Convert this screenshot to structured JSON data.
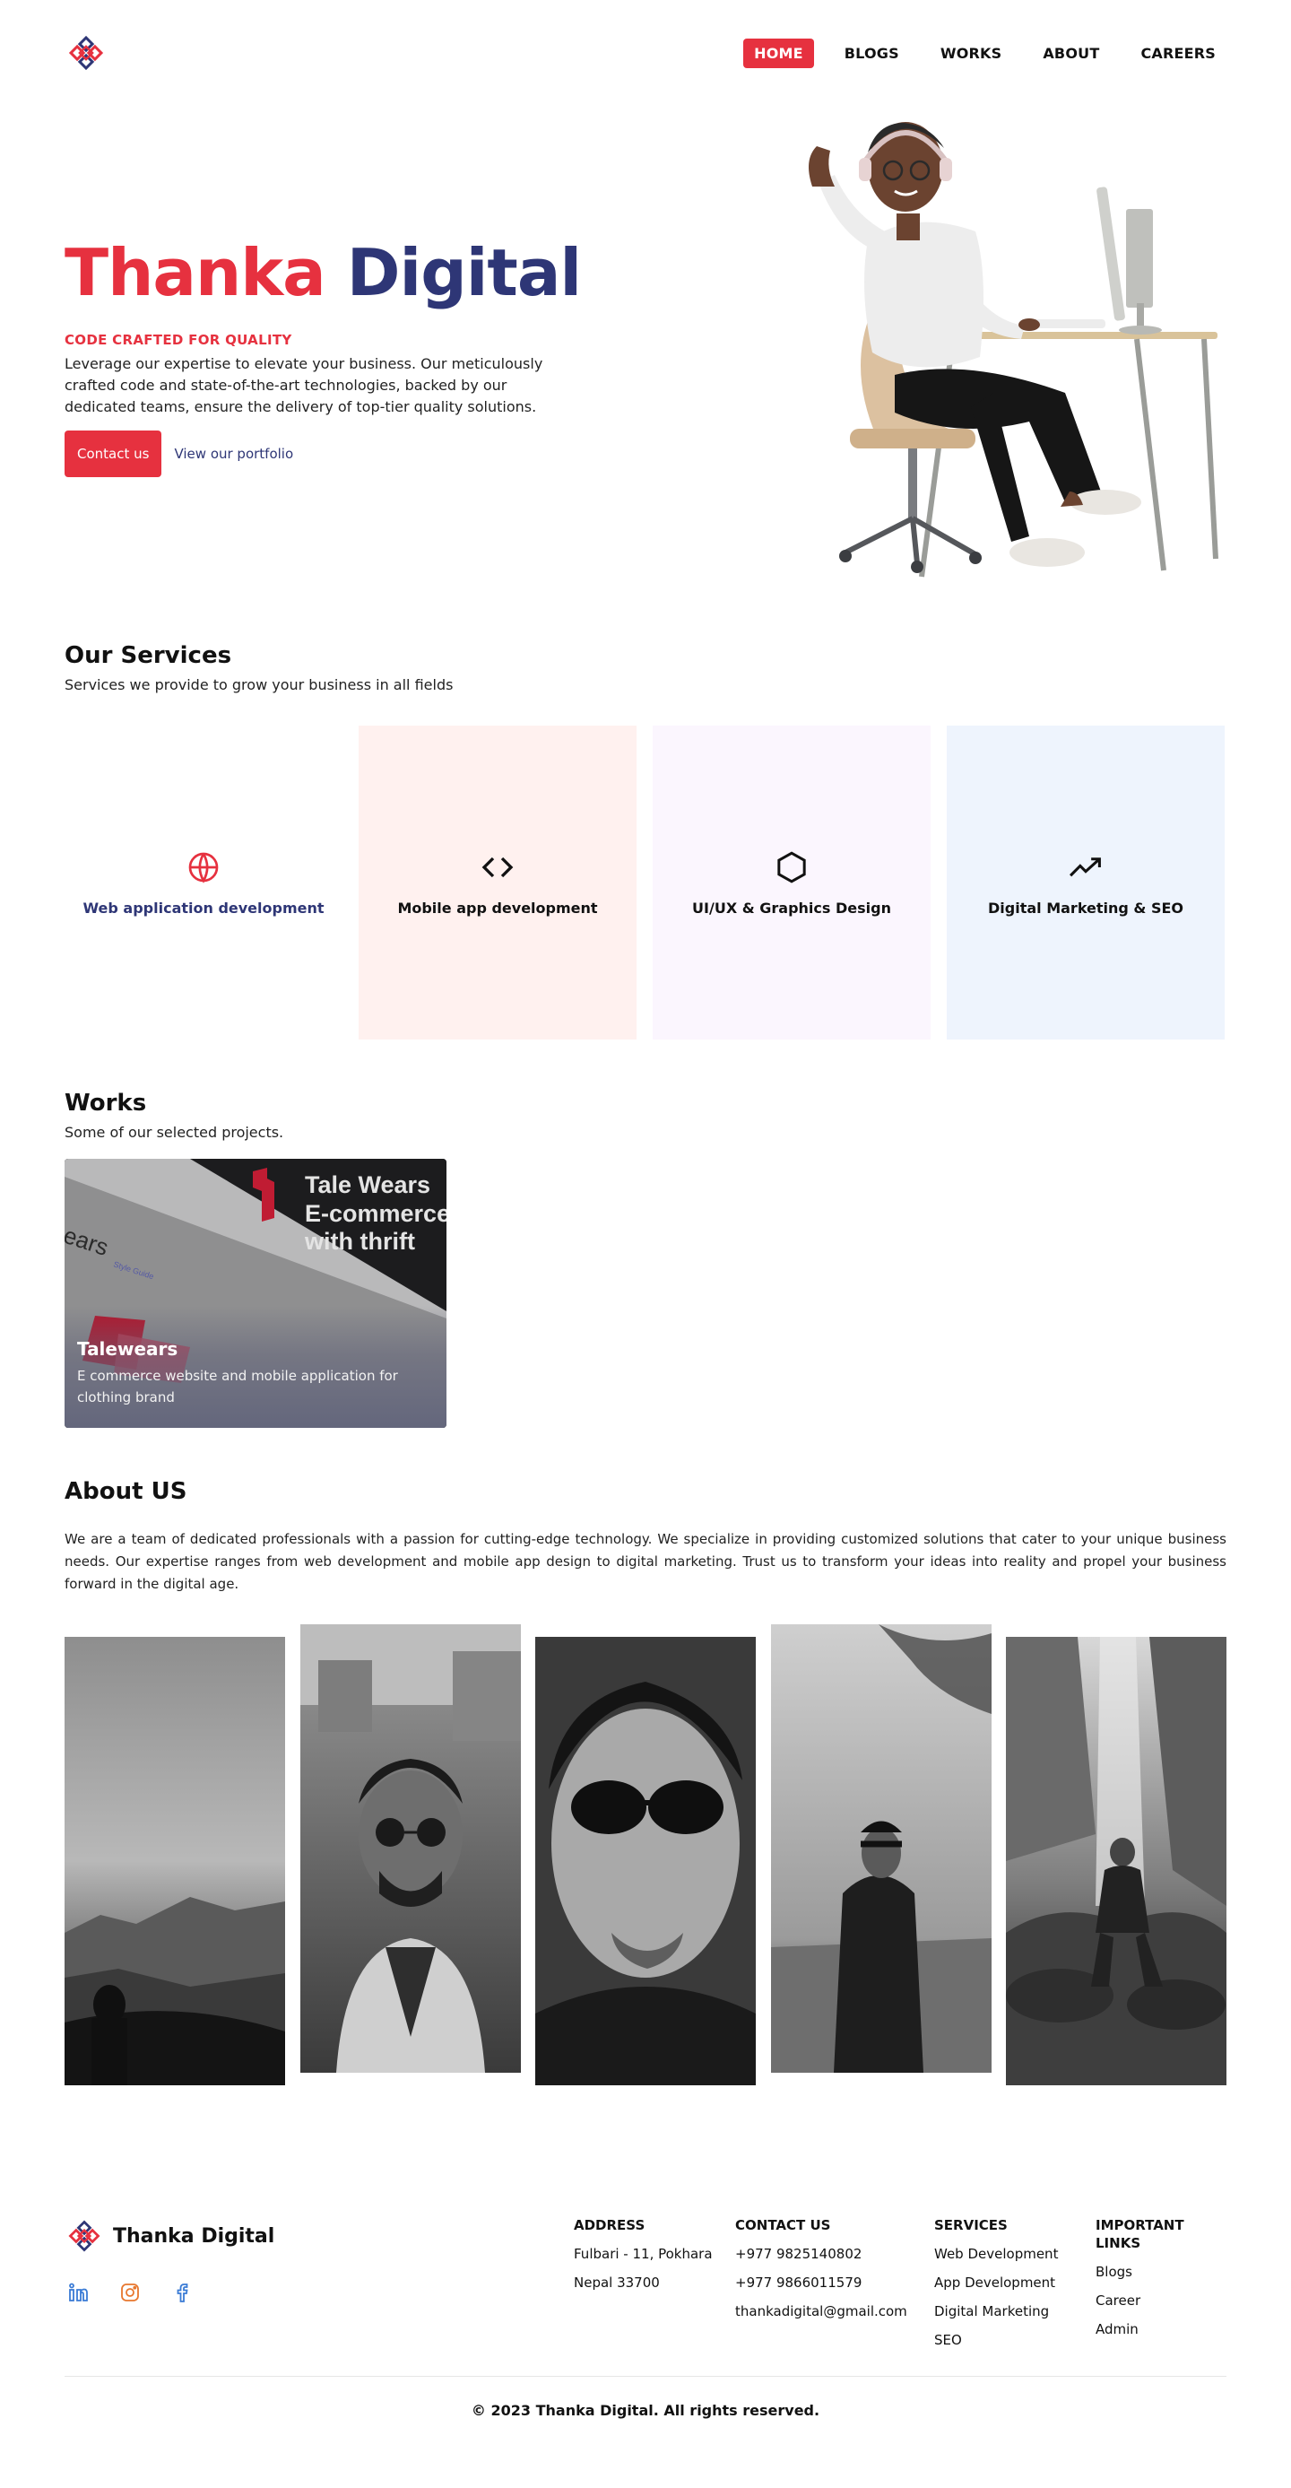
{
  "nav": {
    "items": [
      {
        "label": "HOME",
        "active": true
      },
      {
        "label": "BLOGS",
        "active": false
      },
      {
        "label": "WORKS",
        "active": false
      },
      {
        "label": "ABOUT",
        "active": false
      },
      {
        "label": "CAREERS",
        "active": false
      }
    ]
  },
  "hero": {
    "title_red": "Thanka",
    "title_blue": "Digital",
    "tagline": "CODE CRAFTED FOR QUALITY",
    "description": "Leverage our expertise to elevate your business. Our meticulously crafted code and state-of-the-art technologies, backed by our dedicated teams, ensure the delivery of top-tier quality solutions.",
    "cta_primary": "Contact us",
    "cta_secondary": "View our portfolio"
  },
  "services": {
    "title": "Our Services",
    "subtitle": "Services we provide to grow your business in all fields",
    "items": [
      {
        "label": "Web application development",
        "icon": "globe-icon"
      },
      {
        "label": "Mobile app development",
        "icon": "code-icon"
      },
      {
        "label": "UI/UX & Graphics Design",
        "icon": "hexagon-icon"
      },
      {
        "label": "Digital Marketing & SEO",
        "icon": "trending-up-icon"
      }
    ]
  },
  "works": {
    "title": "Works",
    "subtitle": "Some of our selected projects.",
    "items": [
      {
        "title": "Talewears",
        "description": "E commerce website and mobile application for clothing brand",
        "image_text": [
          "Tale Wears",
          "E-commerce",
          "with thrift"
        ],
        "image_side_text": "ears",
        "image_side_small": "Style Guide"
      }
    ]
  },
  "about": {
    "title": "About US",
    "text": "We are a team of dedicated professionals with a passion for cutting-edge technology. We specialize in providing customized solutions that cater to your unique business needs. Our expertise ranges from web development and mobile app design to digital marketing. Trust us to transform your ideas into reality and propel your business forward in the digital age."
  },
  "footer": {
    "brand": "Thanka Digital",
    "socials": [
      "linkedin-icon",
      "instagram-icon",
      "facebook-icon"
    ],
    "columns": {
      "address": {
        "title": "ADDRESS",
        "lines": [
          "Fulbari - 11, Pokhara",
          "Nepal 33700"
        ]
      },
      "contact": {
        "title": "CONTACT US",
        "lines": [
          "+977 9825140802",
          "+977 9866011579",
          "thankadigital@gmail.com"
        ]
      },
      "services": {
        "title": "SERVICES",
        "lines": [
          "Web Development",
          "App Development",
          "Digital Marketing",
          "SEO"
        ]
      },
      "links": {
        "title": "IMPORTANT LINKS",
        "lines": [
          "Blogs",
          "Career",
          "Admin"
        ]
      }
    },
    "copyright": "© 2023 Thanka Digital. All rights reserved."
  },
  "colors": {
    "brand_red": "#e6313f",
    "brand_blue": "#2e3676"
  }
}
